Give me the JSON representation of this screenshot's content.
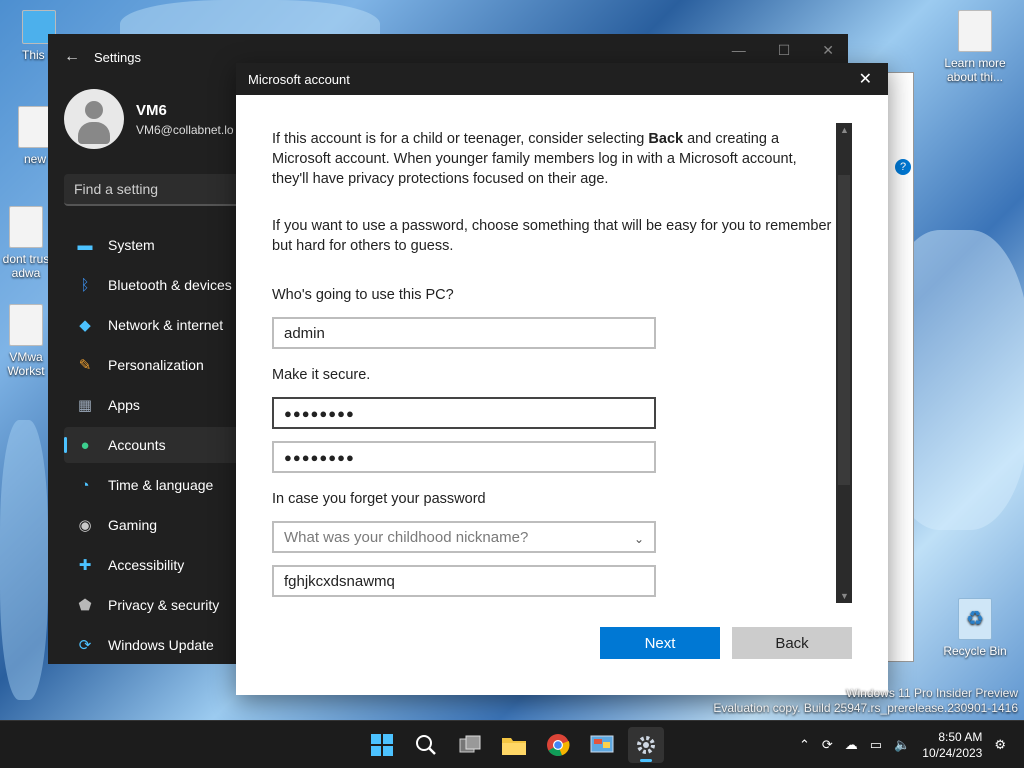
{
  "desktop": {
    "icons_left": [
      {
        "label": "This P"
      },
      {
        "label": "new"
      },
      {
        "label": "dont trus adwa"
      },
      {
        "label": "VMwa Workst"
      }
    ],
    "icons_right": [
      {
        "label": "Learn more about thi..."
      },
      {
        "label": "Recycle Bin"
      }
    ],
    "watermark_line1": "Windows 11 Pro Insider Preview",
    "watermark_line2": "Evaluation copy. Build 25947.rs_prerelease.230901-1416"
  },
  "settings": {
    "title": "Settings",
    "user_name": "VM6",
    "user_email": "VM6@collabnet.lo",
    "search_placeholder": "Find a setting",
    "nav": [
      {
        "label": "System",
        "icon": "monitor-icon",
        "color": "#4cc2ff"
      },
      {
        "label": "Bluetooth & devices",
        "icon": "bluetooth-icon",
        "color": "#3b8eea"
      },
      {
        "label": "Network & internet",
        "icon": "wifi-icon",
        "color": "#4cc2ff"
      },
      {
        "label": "Personalization",
        "icon": "brush-icon",
        "color": "#f0a030"
      },
      {
        "label": "Apps",
        "icon": "apps-icon",
        "color": "#9aa7b8"
      },
      {
        "label": "Accounts",
        "icon": "person-icon",
        "color": "#3ccf8e"
      },
      {
        "label": "Time & language",
        "icon": "globe-clock-icon",
        "color": "#4cc2ff"
      },
      {
        "label": "Gaming",
        "icon": "gamepad-icon",
        "color": "#c9c9c9"
      },
      {
        "label": "Accessibility",
        "icon": "accessibility-icon",
        "color": "#4cc2ff"
      },
      {
        "label": "Privacy & security",
        "icon": "shield-icon",
        "color": "#b8b8b8"
      },
      {
        "label": "Windows Update",
        "icon": "update-icon",
        "color": "#4cc2ff"
      }
    ],
    "active_index": 5
  },
  "dialog": {
    "title": "Microsoft account",
    "para1_line1_pre": "If this account is for a child or teenager, consider selecting ",
    "para1_bold": "Back",
    "para1_line1_post": " and creating a",
    "para1_line2": "Microsoft account. When younger family members log in with a Microsoft account,",
    "para1_line3": "they'll have privacy protections focused on their age.",
    "para2_line1": "If you want to use a password, choose something that will be easy for you to remember",
    "para2_line2": "but hard for others to guess.",
    "who_label": "Who's going to use this PC?",
    "username_value": "admin",
    "secure_label": "Make it secure.",
    "password_value": "●●●●●●●●",
    "confirm_value": "●●●●●●●●",
    "forget_label": "In case you forget your password",
    "question_placeholder": "What was your childhood nickname?",
    "answer_value": "fghjkcxdsnawmq",
    "next_label": "Next",
    "back_label": "Back"
  },
  "taskbar": {
    "time": "8:50 AM",
    "date": "10/24/2023",
    "accent": "#4cc2ff"
  }
}
